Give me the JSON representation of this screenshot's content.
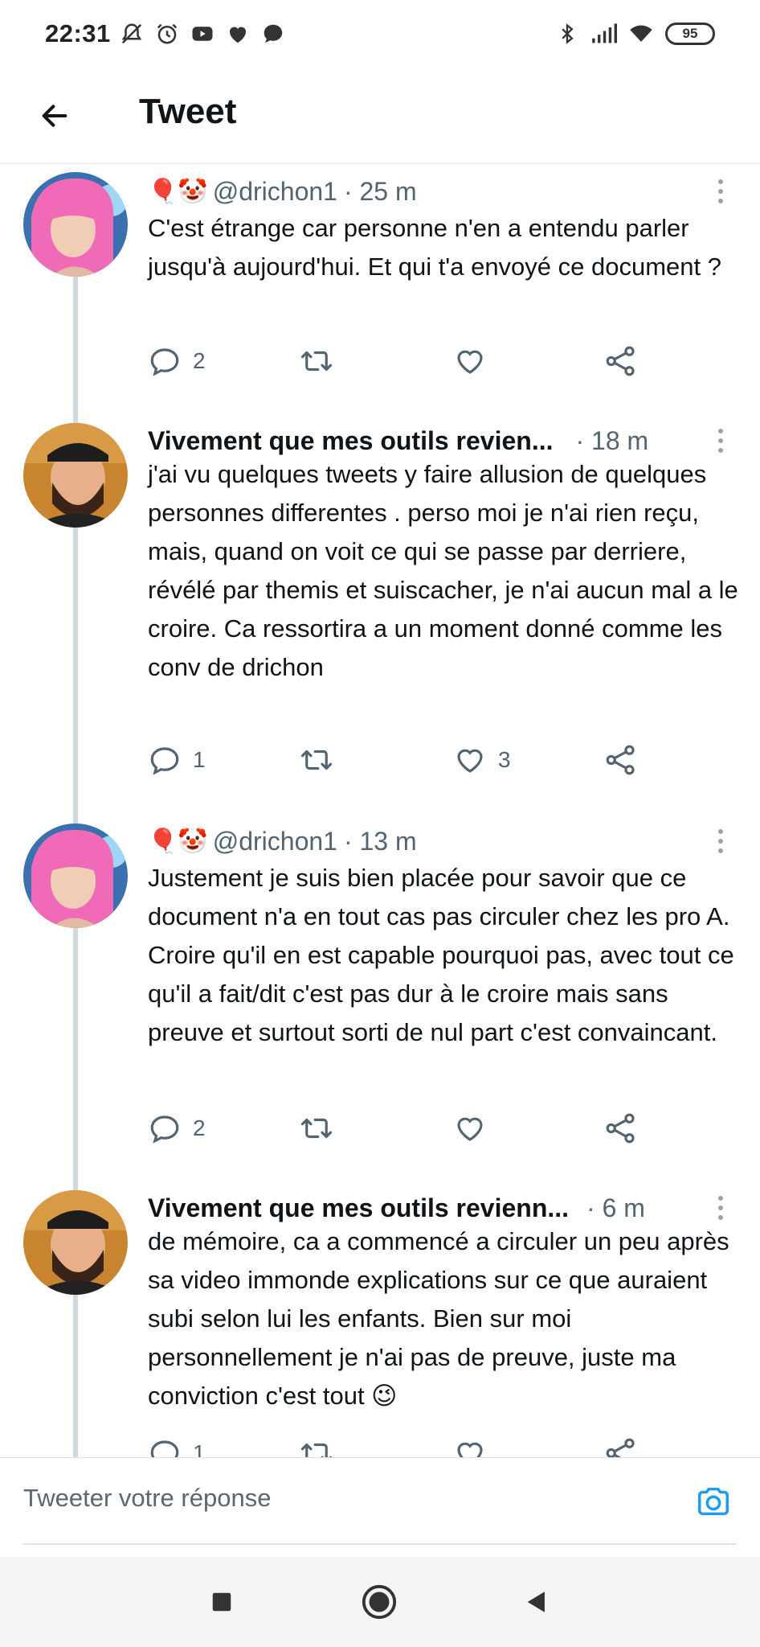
{
  "status_bar": {
    "time": "22:31",
    "battery": "95",
    "left_icons": [
      "mute-icon",
      "alarm-icon",
      "youtube-icon",
      "heart-icon",
      "chat-bubble-icon"
    ],
    "right_icons": [
      "bluetooth-icon",
      "signal-icon",
      "wifi-icon",
      "battery-icon"
    ]
  },
  "header": {
    "title": "Tweet"
  },
  "tweets": [
    {
      "emojis": "🎈🤡",
      "name": "",
      "handle": "@drichon1",
      "time": "· 25 m",
      "text": "C'est étrange car personne n'en a entendu parler jusqu'à aujourd'hui. Et qui t'a envoyé ce document ?",
      "replies": "2",
      "retweets": "",
      "likes": ""
    },
    {
      "emojis": "",
      "name": "Vivement que mes outils revien...",
      "handle": "",
      "time": "· 18 m",
      "text": "j'ai vu quelques tweets y faire allusion de quelques personnes differentes . perso moi je n'ai rien reçu, mais, quand on voit ce qui se passe par derriere, révélé par themis et suiscacher, je n'ai aucun mal a le croire. Ca ressortira a un moment donné comme les conv de drichon",
      "replies": "1",
      "retweets": "",
      "likes": "3"
    },
    {
      "emojis": "🎈🤡",
      "name": "",
      "handle": "@drichon1",
      "time": "· 13 m",
      "text": "Justement je suis bien placée pour savoir que ce document n'a en tout cas pas circuler chez les pro A. Croire qu'il en est capable pourquoi pas, avec tout ce qu'il a fait/dit c'est pas dur à le croire mais sans preuve et surtout sorti de nul part c'est convaincant.",
      "replies": "2",
      "retweets": "",
      "likes": ""
    },
    {
      "emojis": "",
      "name": "Vivement que mes outils revienn...",
      "handle": "",
      "time": "· 6 m",
      "text": "de mémoire, ca a commencé a circuler un peu après sa video immonde explications sur ce que auraient subi selon lui les enfants. Bien sur moi personnellement je n'ai pas de preuve, juste ma conviction c'est tout 😉",
      "replies": "1",
      "retweets": "",
      "likes": ""
    }
  ],
  "compose": {
    "placeholder": "Tweeter votre réponse"
  },
  "colors": {
    "text": "#0f1419",
    "secondary": "#536471",
    "thread_line": "#cfd9de",
    "accent": "#1d9bf0"
  }
}
